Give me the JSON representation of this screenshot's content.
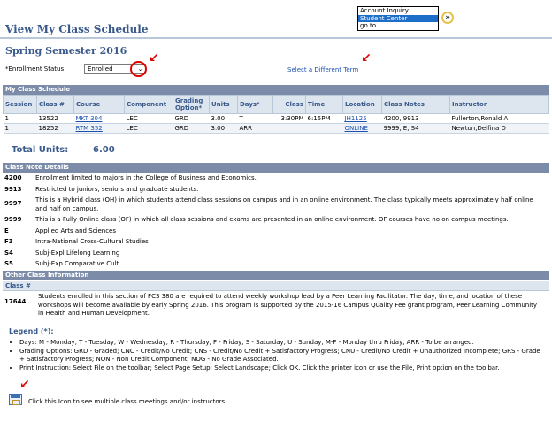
{
  "header": {
    "title": "View My Class Schedule"
  },
  "nav": {
    "items": [
      "Account Inquiry",
      "Student Center",
      "go to ..."
    ],
    "selected_index": 1
  },
  "semester": "Spring Semester 2016",
  "enrollment": {
    "label": "*Enrollment Status",
    "value": "Enrolled",
    "select_term_link": "Select a Different Term"
  },
  "schedule": {
    "section_title": "My Class Schedule",
    "columns": [
      "Session",
      "Class #",
      "Course",
      "Component",
      "Grading Option*",
      "Units",
      "Days*",
      "Class",
      "Time",
      "Location",
      "Class Notes",
      "Instructor"
    ],
    "rows": [
      [
        "1",
        "13522",
        "MKT 304",
        "LEC",
        "GRD",
        "3.00",
        "T",
        "3:30PM",
        "6:15PM",
        "JH1125",
        "4200, 9913",
        "Fullerton,Ronald A"
      ],
      [
        "1",
        "18252",
        "RTM 352",
        "LEC",
        "GRD",
        "3.00",
        "ARR",
        "",
        "",
        "ONLINE",
        "9999, E, S4",
        "Newton,Delfina D"
      ]
    ]
  },
  "total": {
    "label": "Total Units:",
    "value": "6.00"
  },
  "class_notes": {
    "section_title": "Class Note Details",
    "items": [
      {
        "code": "4200",
        "text": "Enrollment limited to majors in the College of Business and Economics."
      },
      {
        "code": "9913",
        "text": "Restricted to juniors, seniors and graduate students."
      },
      {
        "code": "9997",
        "text": "This is a Hybrid class (OH) in which students attend class sessions on campus and in an online environment. The class typically meets approximately half online and half on campus."
      },
      {
        "code": "9999",
        "text": "This is a Fully Online class (OF) in which all class sessions and exams are presented in an online environment. OF courses have no on campus meetings."
      },
      {
        "code": "E",
        "text": "Applied Arts and Sciences"
      },
      {
        "code": "F3",
        "text": "Intra-National Cross-Cultural Studies"
      },
      {
        "code": "S4",
        "text": "Subj-Expl Lifelong Learning"
      },
      {
        "code": "S5",
        "text": "Subj-Exp Comparative Cult"
      }
    ]
  },
  "other_info": {
    "section_title": "Other Class Information",
    "column": "Class #",
    "class_number": "17644",
    "text": "Students enrolled in this section of FCS 380 are required to attend weekly workshop lead by a Peer Learning Facilitator. The day, time, and location of these workshops will become available by early Spring 2016. This program is supported by the 2015-16 Campus Quality Fee grant program, Peer Learning Community in Health and Human Development."
  },
  "legend": {
    "title": "Legend (*):",
    "items": [
      "Days: M - Monday, T - Tuesday, W - Wednesday, R - Thursday, F - Friday, S - Saturday, U - Sunday, M-F - Monday thru Friday, ARR - To be arranged.",
      "Grading Options: GRD - Graded; CNC - Credit/No Credit; CNS - Credit/No Credit + Satisfactory Progress; CNU - Credit/No Credit + Unauthorized Incomplete; GRS - Grade + Satisfactory Progress; NON - Non Credit Component; NOG - No Grade Associated.",
      "Print Instruction: Select File on the toolbar; Select Page Setup; Select Landscape; Click OK. Click the printer icon or use the File, Print option on the toolbar."
    ]
  },
  "meetings_note": "Click this Icon to see multiple class meetings and/or instructors.",
  "colors": {
    "title_blue": "#3a5a8c",
    "section_header": "#7b8ba8",
    "link": "#1a4fb0",
    "annotation_red": "#dd0000"
  }
}
